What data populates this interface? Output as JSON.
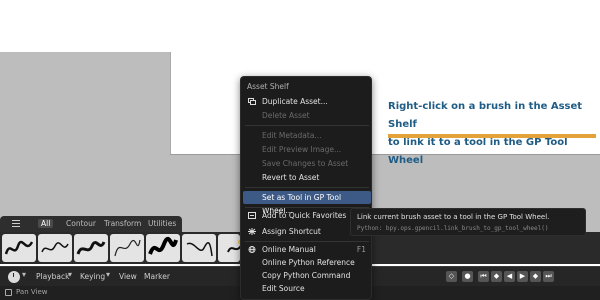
{
  "annotation": {
    "line1": "Right-click on a brush in the Asset Shelf",
    "line2": "to link it to a tool in the GP Tool Wheel",
    "bar_color": "#e3a33a",
    "text_color": "#1f5c85"
  },
  "shelf": {
    "tabs": [
      "All",
      "Contour",
      "Transform",
      "Utilities"
    ],
    "active_tab": "All",
    "menu_icon": "hamburger-icon"
  },
  "context_menu": {
    "title": "Asset Shelf",
    "items": [
      {
        "label": "Duplicate Asset...",
        "icon": "duplicate-icon",
        "enabled": true
      },
      {
        "label": "Delete Asset",
        "enabled": false
      },
      {
        "label": "Edit Metadata...",
        "enabled": false
      },
      {
        "label": "Edit Preview Image...",
        "enabled": false
      },
      {
        "label": "Save Changes to Asset",
        "enabled": false
      },
      {
        "label": "Revert to Asset",
        "enabled": true
      },
      {
        "label": "Set as Tool in GP Tool Wheel...",
        "enabled": true,
        "highlighted": true
      },
      {
        "label": "Add to Quick Favorites",
        "icon": "quick-favorites-icon",
        "enabled": true
      },
      {
        "label": "Assign Shortcut",
        "icon": "shortcut-icon",
        "enabled": true
      },
      {
        "label": "Online Manual",
        "icon": "globe-icon",
        "enabled": true,
        "shortcut": "F1"
      },
      {
        "label": "Online Python Reference",
        "enabled": true
      },
      {
        "label": "Copy Python Command",
        "enabled": true
      },
      {
        "label": "Edit Source",
        "enabled": true
      }
    ]
  },
  "tooltip": {
    "description": "Link current brush asset to a tool in the GP Tool Wheel.",
    "python": "Python: bpy.ops.gpencil.link_brush_to_gp_tool_wheel()"
  },
  "timeline": {
    "items": [
      "Playback",
      "Keying",
      "View",
      "Marker"
    ],
    "transport_icons": [
      "jump-start-icon",
      "keyframe-prev-icon",
      "play-reverse-icon",
      "play-icon",
      "keyframe-next-icon",
      "jump-end-icon"
    ]
  },
  "statusbar": {
    "text": "Pan View"
  }
}
